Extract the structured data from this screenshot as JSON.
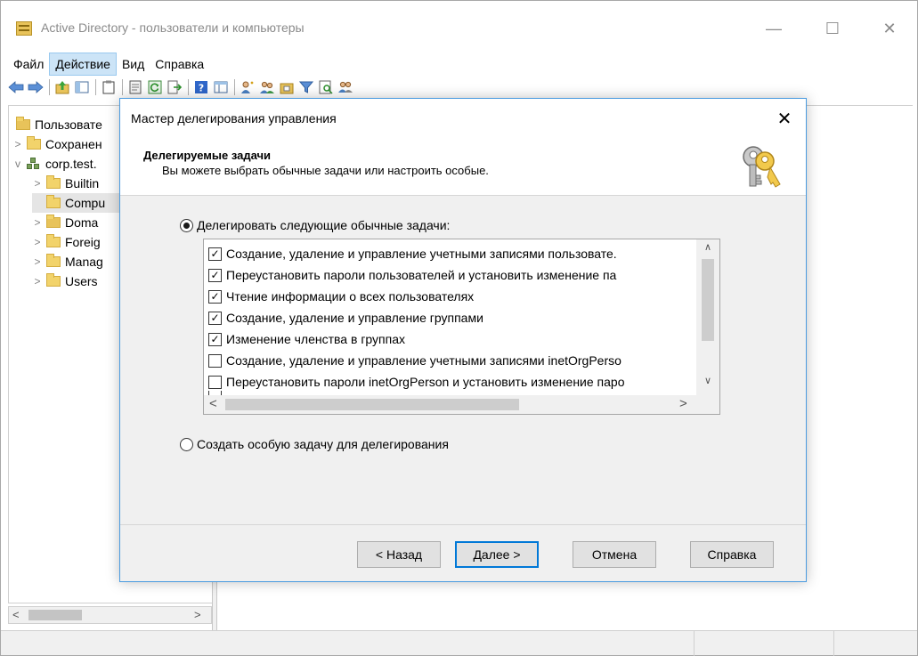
{
  "window": {
    "title": "Active Directory - пользователи и компьютеры",
    "minimize_glyph": "—",
    "maximize_glyph": "☐",
    "close_glyph": "✕"
  },
  "menubar": {
    "items": [
      {
        "label": "Файл"
      },
      {
        "label": "Действие"
      },
      {
        "label": "Вид"
      },
      {
        "label": "Справка"
      }
    ]
  },
  "toolbar": {
    "icons": [
      "back-arrow-icon",
      "forward-arrow-icon",
      "up-folder-icon",
      "show-hide-tree-icon",
      "clipboard-icon",
      "properties-icon",
      "refresh-icon",
      "export-list-icon",
      "help-icon",
      "details-icon",
      "create-user-icon",
      "create-group-icon",
      "create-ou-icon",
      "filter-icon",
      "find-icon",
      "add-to-group-icon"
    ]
  },
  "tree": {
    "items": [
      {
        "label": "Пользовате",
        "expander": "",
        "icon": "snapin-icon"
      },
      {
        "label": "Сохранен",
        "expander": ">",
        "icon": "folder-icon"
      },
      {
        "label": "corp.test.",
        "expander": "v",
        "icon": "domain-icon"
      },
      {
        "label": "Builtin",
        "expander": ">",
        "icon": "folder-icon"
      },
      {
        "label": "Compu",
        "expander": "",
        "icon": "folder-icon",
        "selected": true
      },
      {
        "label": "Doma",
        "expander": ">",
        "icon": "ou-icon"
      },
      {
        "label": "Foreig",
        "expander": ">",
        "icon": "folder-icon"
      },
      {
        "label": "Manag",
        "expander": ">",
        "icon": "folder-icon"
      },
      {
        "label": "Users",
        "expander": ">",
        "icon": "folder-icon"
      }
    ],
    "hscroll_left": "<",
    "hscroll_right": ">"
  },
  "dialog": {
    "title": "Мастер делегирования управления",
    "close_glyph": "✕",
    "heading": "Делегируемые задачи",
    "subheading": "Вы можете выбрать обычные задачи или настроить особые.",
    "radio_common": {
      "label": "Делегировать следующие обычные задачи:",
      "checked": true
    },
    "tasks": [
      {
        "label": "Создание, удаление и управление учетными записями пользовате.",
        "checked": true
      },
      {
        "label": "Переустановить пароли пользователей и установить изменение па",
        "checked": true
      },
      {
        "label": "Чтение информации о всех пользователях",
        "checked": true
      },
      {
        "label": "Создание, удаление и управление группами",
        "checked": true
      },
      {
        "label": "Изменение членства в группах",
        "checked": true
      },
      {
        "label": "Создание, удаление и управление учетными записями inetOrgPerso",
        "checked": false
      },
      {
        "label": "Переустановить пароли inetOrgPerson и установить изменение паро",
        "checked": false
      }
    ],
    "check_glyph": "✓",
    "scroll": {
      "up": "∧",
      "down": "∨",
      "left": "<",
      "right": ">"
    },
    "radio_custom": {
      "label": "Создать особую задачу для делегирования",
      "checked": false
    },
    "buttons": {
      "back": "< Назад",
      "next": "Далее >",
      "cancel": "Отмена",
      "help": "Справка"
    }
  },
  "colors": {
    "accent": "#0078d7",
    "menu_highlight": "#cce4f7",
    "dialog_border": "#4a9be0"
  }
}
